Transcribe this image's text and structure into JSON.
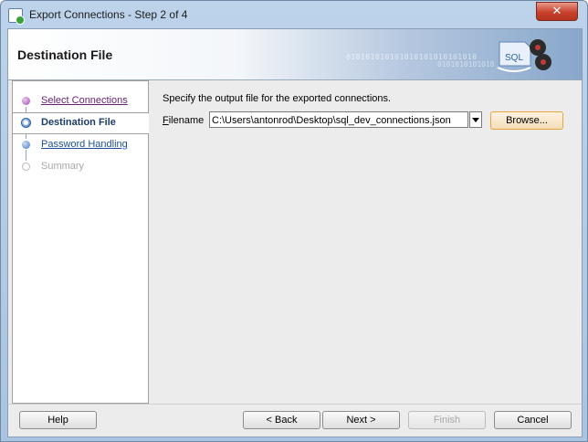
{
  "window": {
    "title": "Export Connections - Step 2 of 4",
    "close_glyph": "✕"
  },
  "header": {
    "title": "Destination File",
    "binary_1": "010101010101010101010101010",
    "binary_2": "0101010101010"
  },
  "steps": [
    {
      "label": "Select Connections",
      "state": "visited"
    },
    {
      "label": "Destination File",
      "state": "current"
    },
    {
      "label": "Password Handling",
      "state": "next"
    },
    {
      "label": "Summary",
      "state": "disabled"
    }
  ],
  "content": {
    "instruction": "Specify the output file for the exported connections.",
    "filename_label_mnemonic": "F",
    "filename_label_rest": "ilename",
    "filename_value": "C:\\Users\\antonrod\\Desktop\\sql_dev_connections.json",
    "browse_label": "Browse..."
  },
  "buttons": {
    "help": "Help",
    "back": "< Back",
    "next": "Next >",
    "finish": "Finish",
    "cancel": "Cancel"
  },
  "colors": {
    "accent": "#3b77c8",
    "visited": "#6a2077",
    "focus_border": "#e6a43a"
  }
}
